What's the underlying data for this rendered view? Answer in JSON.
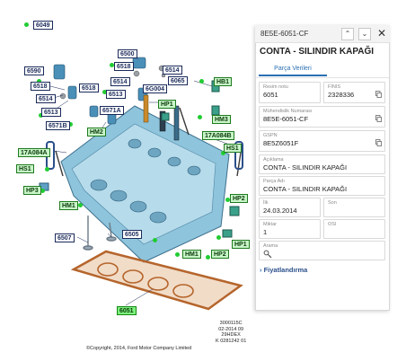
{
  "diagram": {
    "callouts": [
      {
        "id": "c6049",
        "text": "6049",
        "style": "plain"
      },
      {
        "id": "c6500",
        "text": "6500",
        "style": "plain"
      },
      {
        "id": "c6518a",
        "text": "6518",
        "style": "plain"
      },
      {
        "id": "c6514a",
        "text": "6514",
        "style": "plain"
      },
      {
        "id": "c6590",
        "text": "6590",
        "style": "plain"
      },
      {
        "id": "c6518b",
        "text": "6518",
        "style": "plain"
      },
      {
        "id": "c6518c",
        "text": "6518",
        "style": "plain"
      },
      {
        "id": "c6514b",
        "text": "6514",
        "style": "plain"
      },
      {
        "id": "c6G004",
        "text": "6G004",
        "style": "plain"
      },
      {
        "id": "c6065",
        "text": "6065",
        "style": "plain"
      },
      {
        "id": "cHB1",
        "text": "HB1",
        "style": "green"
      },
      {
        "id": "c6514c",
        "text": "6514",
        "style": "plain"
      },
      {
        "id": "c6513a",
        "text": "6513",
        "style": "plain"
      },
      {
        "id": "c6513b",
        "text": "6513",
        "style": "plain"
      },
      {
        "id": "c6571A",
        "text": "6571A",
        "style": "plain"
      },
      {
        "id": "cHP1a",
        "text": "HP1",
        "style": "green"
      },
      {
        "id": "cHM3",
        "text": "HM3",
        "style": "green"
      },
      {
        "id": "c6571B",
        "text": "6571B",
        "style": "plain"
      },
      {
        "id": "cHM2",
        "text": "HM2",
        "style": "green"
      },
      {
        "id": "c17A084Aa",
        "text": "17A084A",
        "style": "green"
      },
      {
        "id": "c17A084Ab",
        "text": "17A084B",
        "style": "green"
      },
      {
        "id": "cHS1a",
        "text": "HS1",
        "style": "green"
      },
      {
        "id": "cHS1b",
        "text": "HS1",
        "style": "green"
      },
      {
        "id": "cHP3",
        "text": "HP3",
        "style": "green"
      },
      {
        "id": "cHM1a",
        "text": "HM1",
        "style": "green"
      },
      {
        "id": "cHP2a",
        "text": "HP2",
        "style": "green"
      },
      {
        "id": "c6507",
        "text": "6507",
        "style": "plain"
      },
      {
        "id": "c6505",
        "text": "6505",
        "style": "plain"
      },
      {
        "id": "cHP1b",
        "text": "HP1",
        "style": "green"
      },
      {
        "id": "cHM1b",
        "text": "HM1",
        "style": "green"
      },
      {
        "id": "cHP2b",
        "text": "HP2",
        "style": "green"
      },
      {
        "id": "c6051",
        "text": "6051",
        "style": "highlight"
      }
    ],
    "footer_codes": [
      "3000115C",
      "02-2014 09",
      "29HDEX",
      "K 0281242 01"
    ],
    "copyright": "©Copyright, 2014, Ford Motor Company Limited"
  },
  "panel": {
    "top_code": "8E5E-6051-CF",
    "nav_up": "⌃",
    "nav_down": "⌄",
    "close": "✕",
    "title": "CONTA - SILINDIR KAPAĞI",
    "tab": "Parça Verileri",
    "fields": {
      "resim_no": {
        "label": "Resim notu",
        "value": "6051"
      },
      "finis": {
        "label": "FINIS",
        "value": "2328336"
      },
      "muhendislik": {
        "label": "Mühendislik Numarası",
        "value": "8E5E-6051-CF"
      },
      "gspn": {
        "label": "GSPN",
        "value": "8E5Z6051F"
      },
      "aciklama": {
        "label": "Açıklama",
        "value": "CONTA - SILINDIR KAPAĞI"
      },
      "parca_adi": {
        "label": "Parça Adı",
        "value": "CONTA - SILINDIR KAPAĞI"
      },
      "ilk": {
        "label": "İlk",
        "value": "24.03.2014"
      },
      "son": {
        "label": "Son",
        "value": ""
      },
      "miktar": {
        "label": "Miktar",
        "value": "1"
      },
      "osi": {
        "label": "OSI",
        "value": ""
      },
      "arama": {
        "label": "Arama",
        "value": ""
      }
    },
    "pricing": "Fiyatlandırma",
    "colors": {
      "accent": "#2a6fb4",
      "gasket": "#b5652c",
      "head": "#8ec4dc"
    }
  }
}
